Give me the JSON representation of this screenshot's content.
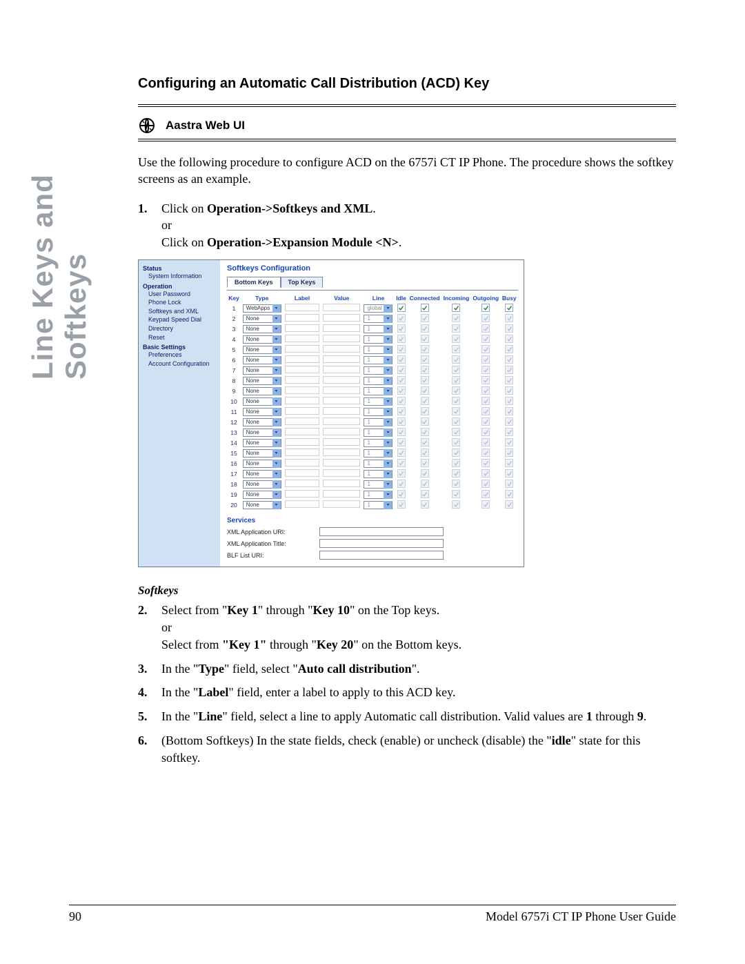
{
  "side_title": "Line Keys and Softkeys",
  "heading": "Configuring an Automatic Call Distribution (ACD) Key",
  "ui_label": "Aastra Web UI",
  "intro": "Use the following procedure to configure ACD on the 6757i CT IP Phone. The procedure shows the softkey screens as an example.",
  "step1_num": "1.",
  "step1_a_pre": "Click on ",
  "step1_a_bold": "Operation->Softkeys and XML",
  "step1_a_post": ".",
  "step1_or": "or",
  "step1_b_pre": "Click on ",
  "step1_b_bold": "Operation->Expansion Module <N>",
  "step1_b_post": ".",
  "panel": {
    "nav": {
      "groups": [
        {
          "label": "Status",
          "items": [
            "System Information"
          ]
        },
        {
          "label": "Operation",
          "items": [
            "User Password",
            "Phone Lock",
            "Softkeys and XML",
            "Keypad Speed Dial",
            "Directory",
            "Reset"
          ]
        },
        {
          "label": "Basic Settings",
          "items": [
            "Preferences",
            "Account Configuration"
          ]
        }
      ]
    },
    "title": "Softkeys Configuration",
    "tabs": {
      "active": "Bottom Keys",
      "other": "Top Keys"
    },
    "headers": [
      "Key",
      "Type",
      "Label",
      "Value",
      "Line",
      "Idle",
      "Connected",
      "Incoming",
      "Outgoing",
      "Busy"
    ],
    "rows": [
      {
        "key": "1",
        "type": "WebApps",
        "line": "global",
        "enabled": true
      },
      {
        "key": "2",
        "type": "None",
        "line": "1",
        "enabled": false
      },
      {
        "key": "3",
        "type": "None",
        "line": "1",
        "enabled": false
      },
      {
        "key": "4",
        "type": "None",
        "line": "1",
        "enabled": false
      },
      {
        "key": "5",
        "type": "None",
        "line": "1",
        "enabled": false
      },
      {
        "key": "6",
        "type": "None",
        "line": "1",
        "enabled": false
      },
      {
        "key": "7",
        "type": "None",
        "line": "1",
        "enabled": false
      },
      {
        "key": "8",
        "type": "None",
        "line": "1",
        "enabled": false
      },
      {
        "key": "9",
        "type": "None",
        "line": "1",
        "enabled": false
      },
      {
        "key": "10",
        "type": "None",
        "line": "1",
        "enabled": false
      },
      {
        "key": "11",
        "type": "None",
        "line": "1",
        "enabled": false
      },
      {
        "key": "12",
        "type": "None",
        "line": "1",
        "enabled": false
      },
      {
        "key": "13",
        "type": "None",
        "line": "1",
        "enabled": false
      },
      {
        "key": "14",
        "type": "None",
        "line": "1",
        "enabled": false
      },
      {
        "key": "15",
        "type": "None",
        "line": "1",
        "enabled": false
      },
      {
        "key": "16",
        "type": "None",
        "line": "1",
        "enabled": false
      },
      {
        "key": "17",
        "type": "None",
        "line": "1",
        "enabled": false
      },
      {
        "key": "18",
        "type": "None",
        "line": "1",
        "enabled": false
      },
      {
        "key": "19",
        "type": "None",
        "line": "1",
        "enabled": false
      },
      {
        "key": "20",
        "type": "None",
        "line": "1",
        "enabled": false
      }
    ],
    "services": {
      "header": "Services",
      "rows": [
        {
          "label": "XML Application URI:"
        },
        {
          "label": "XML Application Title:"
        },
        {
          "label": "BLF List URI:"
        }
      ]
    }
  },
  "subhead": "Softkeys",
  "steps2": [
    {
      "num": "2.",
      "html": "Select from \"<b>Key 1</b>\" through \"<b>Key 10</b>\" on the Top keys.<br>or<br>Select from <b>\"Key 1\"</b> through \"<b>Key 20</b>\" on the Bottom keys."
    },
    {
      "num": "3.",
      "html": "In the \"<b>Type</b>\" field, select \"<b>Auto call distribution</b>\"."
    },
    {
      "num": "4.",
      "html": "In the \"<b>Label</b>\" field, enter a label to apply to this ACD key."
    },
    {
      "num": "5.",
      "html": "In the \"<b>Line</b>\" field, select a line to apply Automatic call distribution. Valid values are <b>1</b> through <b>9</b>."
    },
    {
      "num": "6.",
      "html": "(Bottom Softkeys) In the state fields, check (enable) or uncheck (disable) the \"<b>idle</b>\" state for this softkey."
    }
  ],
  "footer": {
    "page": "90",
    "guide": "Model 6757i CT IP Phone User Guide"
  }
}
